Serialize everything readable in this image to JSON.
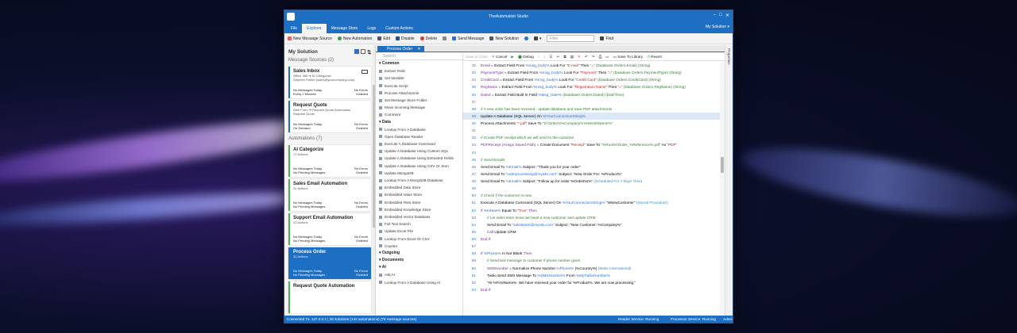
{
  "window": {
    "title": "TheAutomation Studio"
  },
  "menu": {
    "items": [
      "File",
      "Explorer",
      "Message Store",
      "Logs",
      "Custom Actions"
    ],
    "active": "Explorer",
    "solution": "My Solution"
  },
  "toolbar": {
    "new_message_source": "New Message Source",
    "new_automation": "New Automation",
    "edit": "Edit",
    "disable": "Disable",
    "delete": "Delete",
    "send_message": "Send Message",
    "new_solution": "New Solution",
    "filter_placeholder": "Filter",
    "find": "Find"
  },
  "left": {
    "title": "My Solution",
    "message_sources_header": "Message Sources (2)",
    "automations_header": "Automations (7)",
    "sources": [
      {
        "title": "Sales Inbox",
        "line1": "Office 365 ➔ AI Categorize",
        "line2": "Stephen Parker (sales@yourcompany.com)",
        "k1": "No Messages Today",
        "v1": "No Errors",
        "k2": "Every 2 Minutes",
        "v2": "Enabled"
      },
      {
        "title": "Request Quote",
        "line1": "Web Form ➔ Request Quote Automation",
        "line2": "Request Quote",
        "k1": "No Messages Today",
        "v1": "No Errors",
        "k2": "On Demand",
        "v2": "Enabled"
      }
    ],
    "automations": [
      {
        "title": "AI Categorize",
        "line1": "17 Actions",
        "k1": "No Messages Today",
        "v1": "No Errors",
        "k2": "No Pending Messages",
        "v2": "Enabled"
      },
      {
        "title": "Sales Email Automation",
        "line1": "24 Actions",
        "k1": "No Messages Today",
        "v1": "No Errors",
        "k2": "No Pending Messages",
        "v2": "Enabled"
      },
      {
        "title": "Support Email Automation",
        "line1": "21 Actions",
        "k1": "No Messages Today",
        "v1": "No Errors",
        "k2": "No Pending Messages",
        "v2": "Enabled"
      },
      {
        "title": "Process Order",
        "line1": "32 Actions",
        "k1": "No Messages Today",
        "v1": "No Errors",
        "k2": "No Pending Messages",
        "v2": "Enabled"
      },
      {
        "title": "Request Quote Automation",
        "line1": "",
        "k1": "",
        "v1": "",
        "k2": "",
        "v2": ""
      }
    ]
  },
  "tab": {
    "label": "Process Order"
  },
  "actions_panel": {
    "search_placeholder": "Search",
    "items": [
      {
        "type": "group",
        "label": "Common"
      },
      {
        "type": "item",
        "label": "Extract Field"
      },
      {
        "type": "item",
        "label": "Set Variable"
      },
      {
        "type": "item",
        "label": "Execute Script"
      },
      {
        "type": "item",
        "label": "Process Attachments"
      },
      {
        "type": "item",
        "label": "Set Message Store Folder"
      },
      {
        "type": "item",
        "label": "Move Incoming Message"
      },
      {
        "type": "item",
        "label": "Comment"
      },
      {
        "type": "group",
        "label": "Data"
      },
      {
        "type": "item",
        "label": "Lookup From A Database"
      },
      {
        "type": "item",
        "label": "Open Database Reader"
      },
      {
        "type": "item",
        "label": "Execute A Database Command"
      },
      {
        "type": "item",
        "label": "Update A Database Using Custom SQL"
      },
      {
        "type": "item",
        "label": "Update A Database Using Extracted Fields"
      },
      {
        "type": "item",
        "label": "Update A Database Using CSV Or Json"
      },
      {
        "type": "item",
        "label": "Update MongoDB"
      },
      {
        "type": "item",
        "label": "Lookup From A MongoDB Database"
      },
      {
        "type": "item",
        "label": "Embedded Data Store"
      },
      {
        "type": "item",
        "label": "Embedded Value Store"
      },
      {
        "type": "item",
        "label": "Embedded Files Store"
      },
      {
        "type": "item",
        "label": "Embedded Knowledge Store"
      },
      {
        "type": "item",
        "label": "Embedded Vector Database"
      },
      {
        "type": "item",
        "label": "Full Text Search"
      },
      {
        "type": "item",
        "label": "Update Excel File"
      },
      {
        "type": "item",
        "label": "Lookup From Excel Or CSV"
      },
      {
        "type": "item",
        "label": "Counter"
      },
      {
        "type": "group",
        "label": "Outgoing"
      },
      {
        "type": "group",
        "label": "Documents"
      },
      {
        "type": "group",
        "label": "AI"
      },
      {
        "type": "item",
        "label": "Ask AI"
      },
      {
        "type": "item",
        "label": "Lookup From A Database Using AI"
      }
    ]
  },
  "editor_toolbar": {
    "save_close": "Save & Close",
    "cancel": "Cancel",
    "debug": "Debug",
    "save_to_library": "Save To Library",
    "revert": "Revert"
  },
  "code_lines": [
    {
      "n": "32",
      "segs": [
        [
          "Email",
          "#7a2a9a"
        ],
        [
          " = Extract Field From ",
          "#000"
        ],
        [
          "%msg_body%",
          "#2f6fd0"
        ],
        [
          " Look For ",
          "#000"
        ],
        [
          "\"E-mail\"",
          "#b22"
        ],
        [
          " Then ",
          "#000"
        ],
        [
          "\"=\"",
          "#b22"
        ],
        [
          "  (Database Orders.Email) (String)",
          "#2e7d32"
        ]
      ]
    },
    {
      "n": "33",
      "segs": [
        [
          "PaymentType",
          "#7a2a9a"
        ],
        [
          " = Extract Field From ",
          "#000"
        ],
        [
          "%msg_body%",
          "#2f6fd0"
        ],
        [
          " Look For ",
          "#000"
        ],
        [
          "\"Payment\"",
          "#b22"
        ],
        [
          " Then ",
          "#000"
        ],
        [
          "\"=\"",
          "#b22"
        ],
        [
          "  (Database Orders.PaymentType) (String)",
          "#2e7d32"
        ]
      ]
    },
    {
      "n": "34",
      "segs": [
        [
          "CreditCard",
          "#7a2a9a"
        ],
        [
          " = Extract Field From ",
          "#000"
        ],
        [
          "%msg_body%",
          "#2f6fd0"
        ],
        [
          " Look For ",
          "#000"
        ],
        [
          "\"Credit Card\"",
          "#b22"
        ],
        [
          "  (Database Orders.CreditCard) (String)",
          "#2e7d32"
        ]
      ]
    },
    {
      "n": "35",
      "segs": [
        [
          "RegName",
          "#7a2a9a"
        ],
        [
          " = Extract Field From ",
          "#000"
        ],
        [
          "%msg_body%",
          "#2f6fd0"
        ],
        [
          " Look For ",
          "#000"
        ],
        [
          "\"Registration Name\"",
          "#b22"
        ],
        [
          " Then ",
          "#000"
        ],
        [
          "\"=\"",
          "#b22"
        ],
        [
          "  (Database Orders.RegName) (String)",
          "#2e7d32"
        ]
      ]
    },
    {
      "n": "36",
      "segs": [
        [
          "Dated",
          "#7a2a9a"
        ],
        [
          " = Extract Field Built In Field ",
          "#000"
        ],
        [
          "%Msg_Date%",
          "#2f6fd0"
        ],
        [
          "  (Database Orders.Dated) (DateTime)",
          "#2e7d32"
        ]
      ]
    },
    {
      "n": "37",
      "segs": []
    },
    {
      "n": "38",
      "segs": [
        [
          "// A new order has been received - update database and save PDF attachments",
          "#2e7d32"
        ]
      ]
    },
    {
      "n": "39",
      "hl": true,
      "segs": [
        [
          "Update A Database (SQL Server)",
          "#000"
        ],
        [
          " On ",
          "#000"
        ],
        [
          "%YourConnectionString%",
          "#2f6fd0"
        ]
      ]
    },
    {
      "n": "40",
      "segs": [
        [
          "Process Attachments ",
          "#000"
        ],
        [
          "\"*.pdf\"",
          "#b22"
        ],
        [
          " Save To ",
          "#000"
        ],
        [
          "\"D:\\Orders\\%Company%\\%MonthName%\"",
          "#2e7d32"
        ]
      ]
    },
    {
      "n": "41",
      "segs": []
    },
    {
      "n": "42",
      "segs": [
        [
          "// Create PDF receipt which we will send to the customer",
          "#2e7d32"
        ]
      ]
    },
    {
      "n": "43",
      "segs": [
        [
          "PDFReceipt (Assign Saved Path)",
          "#7a2a9a"
        ],
        [
          " = Create Document ",
          "#000"
        ],
        [
          "\"Receipt\"",
          "#b22"
        ],
        [
          " Save To ",
          "#000"
        ],
        [
          "\"%Root%\\Order_%Reference%.pdf\"",
          "#2e7d32"
        ],
        [
          " As ",
          "#000"
        ],
        [
          "\"PDF\"",
          "#b22"
        ]
      ]
    },
    {
      "n": "44",
      "segs": []
    },
    {
      "n": "45",
      "segs": [
        [
          "// Send Emails",
          "#2e7d32"
        ]
      ]
    },
    {
      "n": "46",
      "segs": [
        [
          "Send Email To ",
          "#000"
        ],
        [
          "%Email%",
          "#2f6fd0"
        ],
        [
          " Subject: ",
          "#000"
        ],
        [
          "\"Thank you for your order\"",
          "#000"
        ]
      ]
    },
    {
      "n": "47",
      "segs": [
        [
          "Send Email To ",
          "#000"
        ],
        [
          "\"orderprocessing@mysite.com\"",
          "#2f6fd0"
        ],
        [
          " Subject: ",
          "#000"
        ],
        [
          "\"New Order For: %Product%\"",
          "#000"
        ]
      ]
    },
    {
      "n": "48",
      "segs": [
        [
          "Send Email To ",
          "#000"
        ],
        [
          "%Email%",
          "#2f6fd0"
        ],
        [
          " Subject: ",
          "#000"
        ],
        [
          "\"Follow up for order %OrderNo%\"",
          "#000"
        ],
        [
          "  (Scheduled For 7 Days Time)",
          "#2f8fd0"
        ]
      ]
    },
    {
      "n": "49",
      "segs": []
    },
    {
      "n": "50",
      "segs": [
        [
          "// Check if the customer is new",
          "#2e7d32"
        ]
      ]
    },
    {
      "n": "51",
      "segs": [
        [
          "Execute A Database Command (SQL Server)",
          "#000"
        ],
        [
          " On ",
          "#000"
        ],
        [
          "%YourConnectionString%",
          "#2f6fd0"
        ],
        [
          " \"IsNewCustomer\"",
          "#000"
        ],
        [
          "  (Stored Procedure)",
          "#2f8fd0"
        ]
      ]
    },
    {
      "n": "52",
      "segs": [
        [
          "If ",
          "#7a2a9a"
        ],
        [
          "%IsNew%",
          "#2f6fd0"
        ],
        [
          " Equal To ",
          "#000"
        ],
        [
          "\"True\"",
          "#b22"
        ],
        [
          " Then",
          "#7a2a9a"
        ]
      ]
    },
    {
      "n": "53",
      "indent": 1,
      "segs": [
        [
          "// Let sales team know we have a new customer and update CRM",
          "#2e7d32"
        ]
      ]
    },
    {
      "n": "54",
      "indent": 1,
      "segs": [
        [
          "Send Email To ",
          "#000"
        ],
        [
          "\"salesteam@mysite.com\"",
          "#2f6fd0"
        ],
        [
          " Subject: ",
          "#000"
        ],
        [
          "\"New Customer: %Company%\"",
          "#000"
        ]
      ]
    },
    {
      "n": "55",
      "indent": 1,
      "segs": [
        [
          "Call ",
          "#7a2a9a"
        ],
        [
          "Update CRM",
          "#000"
        ]
      ]
    },
    {
      "n": "56",
      "segs": [
        [
          "End If",
          "#7a2a9a"
        ]
      ]
    },
    {
      "n": "57",
      "segs": []
    },
    {
      "n": "58",
      "segs": [
        [
          "If ",
          "#7a2a9a"
        ],
        [
          "%Phone%",
          "#2f6fd0"
        ],
        [
          " Is Not Blank ",
          "#000"
        ],
        [
          "Then",
          "#7a2a9a"
        ]
      ]
    },
    {
      "n": "59",
      "indent": 1,
      "segs": [
        [
          "// Send text message to customer if phone number given",
          "#2e7d32"
        ]
      ]
    },
    {
      "n": "60",
      "indent": 1,
      "segs": [
        [
          "SMSNumber",
          "#7a2a9a"
        ],
        [
          " = Normalize Phone Number ",
          "#000"
        ],
        [
          "%Phone%",
          "#2f6fd0"
        ],
        [
          " (%Country%)",
          "#000"
        ],
        [
          "  (Make International)",
          "#2f8fd0"
        ]
      ]
    },
    {
      "n": "61",
      "indent": 1,
      "segs": [
        [
          "Twilio Send SMS Message To ",
          "#000"
        ],
        [
          "%SMSNumber%",
          "#2f6fd0"
        ],
        [
          " From ",
          "#000"
        ],
        [
          "%MyTwilioNumber%",
          "#2f6fd0"
        ]
      ]
    },
    {
      "n": "62",
      "indent": 1,
      "segs": [
        [
          "\"Hi %FirstName%. We have received your order for %Product%. We are now processing.\"",
          "#000"
        ]
      ]
    },
    {
      "n": "63",
      "segs": [
        [
          "End If",
          "#7a2a9a"
        ]
      ]
    }
  ],
  "right_side": {
    "label": "Properties"
  },
  "status": {
    "connection": "Connected To: 127.0.0.1 | 26 solutions (142 automations) (78 message sources)",
    "reader": "Reader Service: Running",
    "processor": "Processor Service: Running",
    "admin": "Admin"
  }
}
